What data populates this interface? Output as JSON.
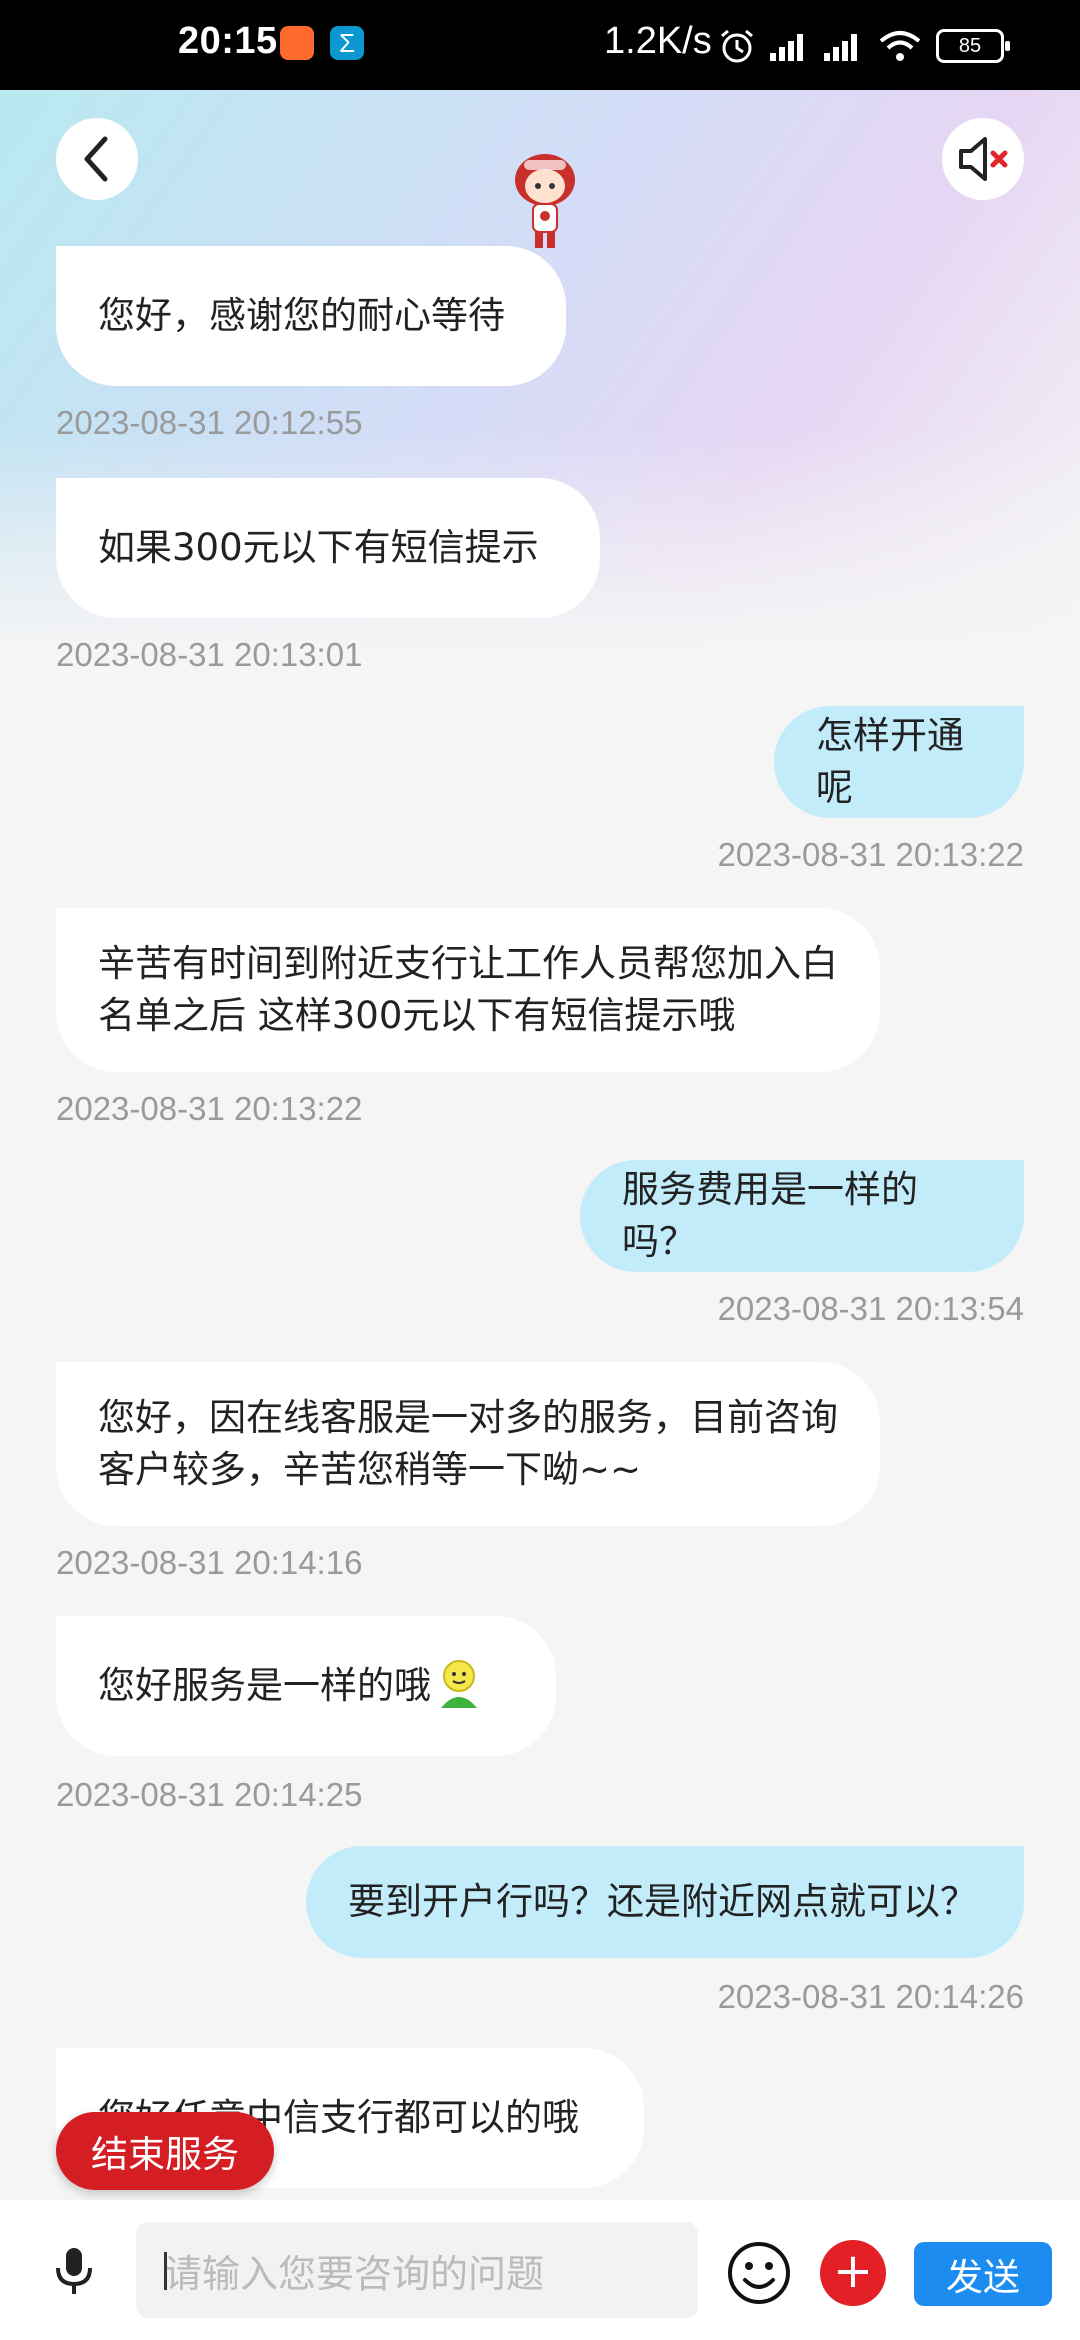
{
  "status_bar": {
    "time": "20:15",
    "net_speed": "1.2K/s",
    "battery": "85"
  },
  "header": {
    "back_icon": "chevron-left-icon",
    "mute_icon": "speaker-muted-icon",
    "mascot": "assistant-mascot"
  },
  "messages": [
    {
      "side": "left",
      "text": "您好，感谢您的耐心等待",
      "time": "2023-08-31 20:12:55"
    },
    {
      "side": "left",
      "text": "如果300元以下有短信提示",
      "time": "2023-08-31 20:13:01"
    },
    {
      "side": "right",
      "text": "怎样开通呢",
      "time": "2023-08-31 20:13:22"
    },
    {
      "side": "left",
      "text": "辛苦有时间到附近支行让工作人员帮您加入白名单之后 这样300元以下有短信提示哦",
      "time": "2023-08-31 20:13:22"
    },
    {
      "side": "right",
      "text": "服务费用是一样的吗？",
      "time": "2023-08-31 20:13:54"
    },
    {
      "side": "left",
      "text": "您好，因在线客服是一对多的服务，目前咨询客户较多，辛苦您稍等一下呦~~",
      "time": "2023-08-31 20:14:16"
    },
    {
      "side": "left",
      "text": "您好服务是一样的哦",
      "time": "2023-08-31 20:14:25"
    },
    {
      "side": "right",
      "text": "要到开户行吗？还是附近网点就可以？",
      "time": "2023-08-31 20:14:26"
    },
    {
      "side": "left",
      "text": "您好任意中信支行都可以的哦",
      "time": ""
    }
  ],
  "end_service_label": "结束服务",
  "input": {
    "placeholder": "请输入您要咨询的问题"
  },
  "send_label": "发送",
  "colors": {
    "accent_red": "#d51e23",
    "send_blue": "#1d8cf0",
    "bubble_right": "#c2ecf9"
  }
}
